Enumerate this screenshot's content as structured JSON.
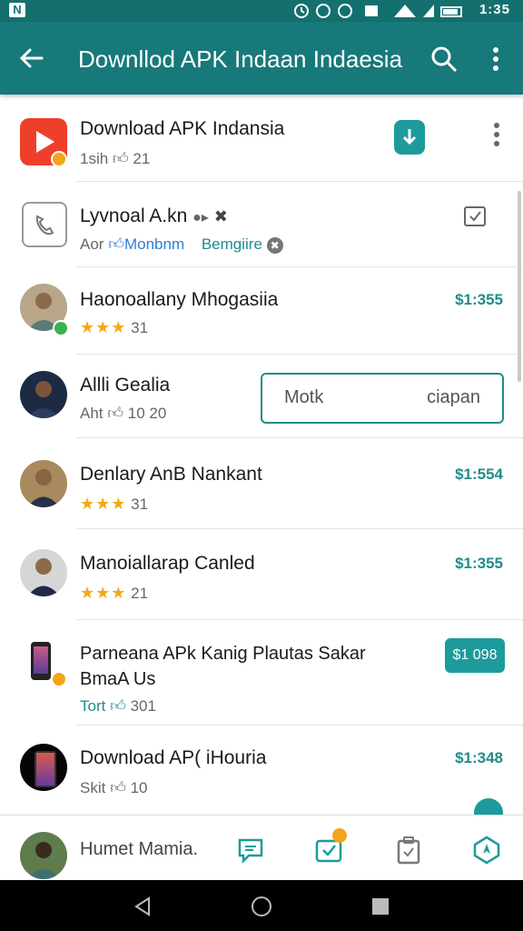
{
  "status_bar": {
    "time": "1:35"
  },
  "app_bar": {
    "title": "Downllod APK Indaan Indaesia"
  },
  "rows": [
    {
      "title": "Download APK Indansia",
      "meta_prefix": "1sih",
      "meta_count": "21"
    },
    {
      "title": "Lyvnoal A.kn",
      "meta_prefix": "Aor",
      "meta_link1": "Monbnm",
      "meta_link2": "Bemgiire"
    },
    {
      "title": "Haonoallany Mhogasiia",
      "rating_count": "31",
      "price": "$1:355"
    },
    {
      "title": "Allli Gealia",
      "meta_prefix": "Aht",
      "meta_count": "10 20",
      "button_left": "Motk",
      "button_right": "ciapan"
    },
    {
      "title": "Denlary AnB Nankant",
      "rating_count": "31",
      "price": "$1:554"
    },
    {
      "title": "Manoiallarap Canled",
      "rating_count": "21",
      "price": "$1:355"
    },
    {
      "title_line1": "Parneana APk Kanig Plautas Sakar",
      "title_line2": "BmaA Us",
      "meta_prefix": "Tort",
      "meta_count": "301",
      "price_button": "$1 098"
    },
    {
      "title": "Download AP( iHouria",
      "meta_prefix": "Skit",
      "meta_count": "10",
      "price": "$1:348"
    }
  ],
  "bottom_bar": {
    "user_name": "Humet Mamia."
  },
  "colors": {
    "primary": "#17797a",
    "accent": "#1f8c8c",
    "star": "#f2a918"
  }
}
